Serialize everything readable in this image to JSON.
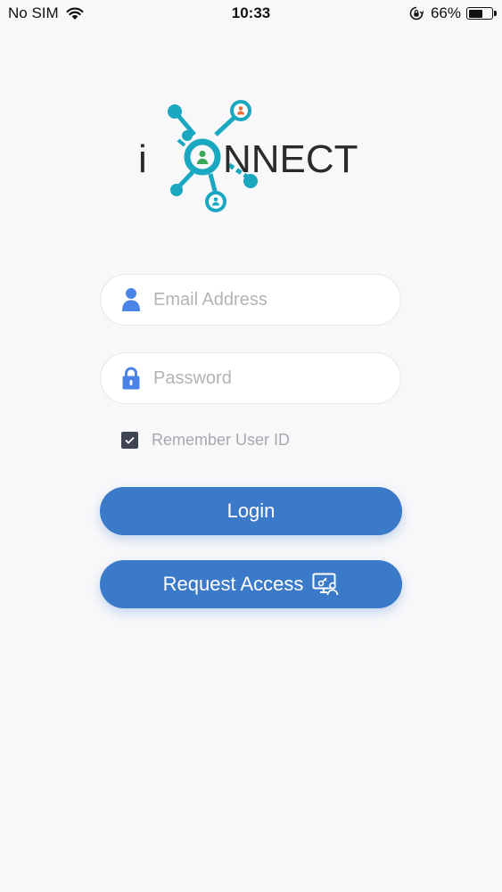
{
  "status_bar": {
    "carrier": "No SIM",
    "time": "10:33",
    "battery_percent": "66%",
    "battery_level": 0.66,
    "icons": [
      "wifi-icon",
      "orientation-lock-icon",
      "battery-icon"
    ]
  },
  "logo": {
    "text_prefix": "i",
    "text_suffix": "NNECT"
  },
  "login_form": {
    "email_placeholder": "Email Address",
    "email_value": "",
    "password_placeholder": "Password",
    "password_value": "",
    "remember_label": "Remember User ID",
    "remember_checked": true,
    "login_label": "Login",
    "request_access_label": "Request Access"
  },
  "colors": {
    "accent": "#3b7ac9",
    "logo_teal": "#1aa7c0",
    "logo_orange": "#e8703a",
    "logo_green": "#3aa757",
    "icon_blue": "#4a84e6",
    "background": "#f8f8fa",
    "placeholder": "#b3b3b8"
  }
}
